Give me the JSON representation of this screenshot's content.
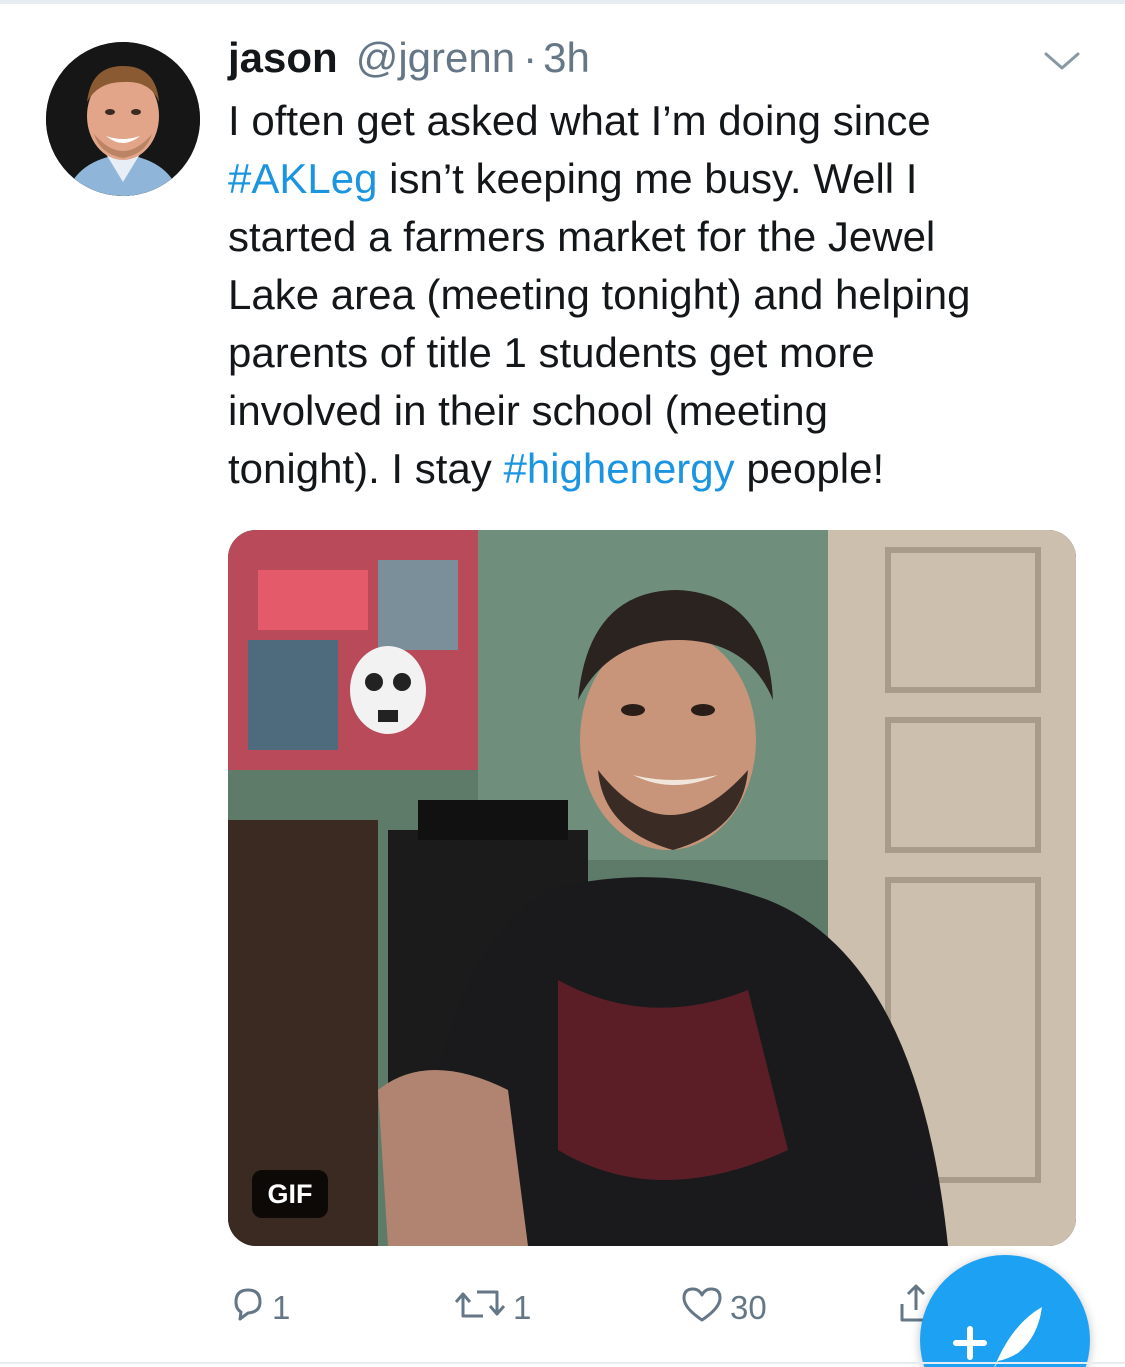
{
  "tweet": {
    "author_name": "jason",
    "author_handle": "@jgrenn",
    "separator": "·",
    "timestamp": "3h",
    "text_lines": [
      {
        "before": "I often get asked what I’m doing since",
        "hashtag": "",
        "after": ""
      },
      {
        "before": "",
        "hashtag": "#AKLeg",
        "after": " isn’t keeping me busy. Well I"
      },
      {
        "before": "started a farmers market for the Jewel",
        "hashtag": "",
        "after": ""
      },
      {
        "before": "Lake area (meeting tonight) and helping",
        "hashtag": "",
        "after": ""
      },
      {
        "before": "parents of title 1 students get more",
        "hashtag": "",
        "after": ""
      },
      {
        "before": "involved in their school (meeting",
        "hashtag": "",
        "after": ""
      },
      {
        "before": "tonight). I stay ",
        "hashtag": "#highenergy",
        "after": " people!"
      }
    ],
    "media_badge": "GIF"
  },
  "actions": {
    "reply_count": "1",
    "retweet_count": "1",
    "like_count": "30"
  },
  "icons": {
    "chevron": "chevron-down-icon",
    "reply": "reply-icon",
    "retweet": "retweet-icon",
    "like": "heart-icon",
    "share": "share-icon",
    "compose": "compose-feather-icon"
  },
  "colors": {
    "link": "#1b95e0",
    "secondary_text": "#657786",
    "fab": "#1da1f2"
  }
}
